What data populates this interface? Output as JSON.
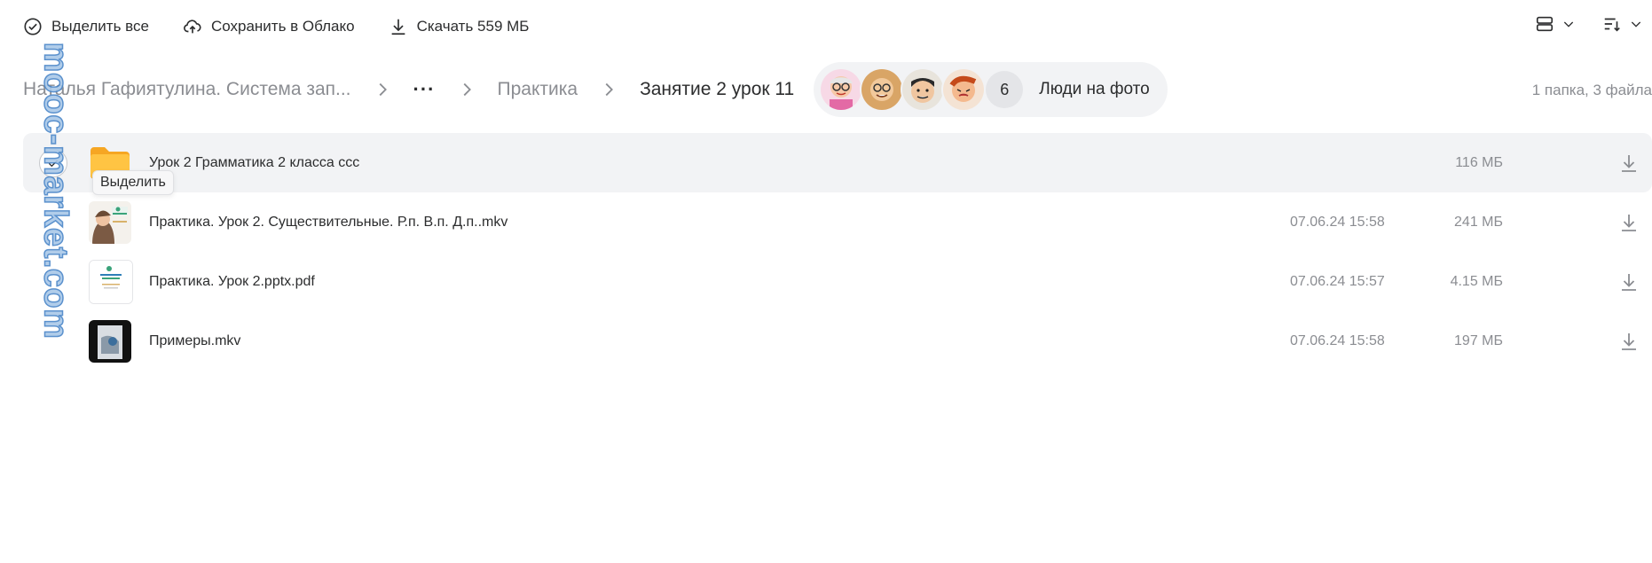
{
  "toolbar": {
    "select_all_label": "Выделить все",
    "save_cloud_label": "Сохранить в Облако",
    "download_label": "Скачать 559 МБ"
  },
  "breadcrumbs": {
    "first": "Наталья Гафиятулина. Система зап...",
    "more": "···",
    "second": "Практика",
    "current": "Занятие 2 урок 11"
  },
  "people": {
    "count": "6",
    "label": "Люди на фото"
  },
  "counter": "1 папка, 3 файла",
  "tooltip": "Выделить",
  "files": [
    {
      "name": "Урок 2 Грамматика 2 класса ссс",
      "date": "",
      "size": "116 МБ",
      "type": "folder"
    },
    {
      "name": "Практика. Урок 2. Существительные. Р.п. В.п. Д.п..mkv",
      "date": "07.06.24 15:58",
      "size": "241 МБ",
      "type": "video"
    },
    {
      "name": "Практика. Урок 2.pptx.pdf",
      "date": "07.06.24 15:57",
      "size": "4.15 МБ",
      "type": "pdf"
    },
    {
      "name": "Примеры.mkv",
      "date": "07.06.24 15:58",
      "size": "197 МБ",
      "type": "video-dark"
    }
  ],
  "watermark": "mooc-market.com",
  "colors": {
    "text": "#2c2d2e",
    "muted": "#8b8d92",
    "hover_bg": "#f2f3f5",
    "folder": "#ffb83b",
    "watermark": "#a9c8e8"
  }
}
